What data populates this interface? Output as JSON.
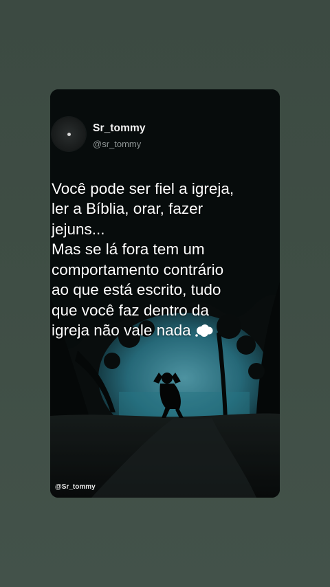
{
  "post": {
    "display_name": "Sr_tommy",
    "handle": "@sr_tommy",
    "text": "Você pode ser fiel a igreja,\nler a Bíblia, orar, fazer\njejuns...\nMas se lá fora tem um\ncomportamento contrário\nao que está escrito, tudo\nque você faz dentro da\nigreja não vale nada",
    "emoji": "thought-balloon-icon"
  },
  "watermark": "@Sr_tommy",
  "colors": {
    "background": "#3f4e45",
    "card": "#0c1212",
    "text": "#ffffff",
    "handle": "#8f9696",
    "water": "#3c8fa0"
  }
}
